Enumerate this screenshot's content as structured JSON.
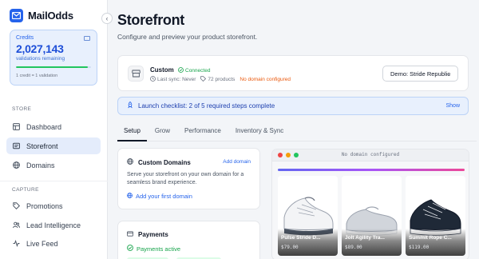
{
  "app": {
    "name": "MailOdds"
  },
  "credits": {
    "label": "Credits",
    "value": "2,027,143",
    "sub": "validations remaining",
    "progress": 0.96,
    "footnote": "1 credit = 1 validation"
  },
  "sidebar": {
    "section_store": "STORE",
    "section_capture": "CAPTURE",
    "items": [
      {
        "label": "Dashboard",
        "icon": "dashboard-icon"
      },
      {
        "label": "Storefront",
        "icon": "storefront-icon",
        "active": true
      },
      {
        "label": "Domains",
        "icon": "globe-icon"
      },
      {
        "label": "Promotions",
        "icon": "tag-icon"
      },
      {
        "label": "Lead Intelligence",
        "icon": "users-icon"
      },
      {
        "label": "Live Feed",
        "icon": "activity-icon"
      }
    ]
  },
  "header": {
    "title": "Storefront",
    "subtitle": "Configure and preview your product storefront."
  },
  "store": {
    "name": "Custom",
    "status": "Connected",
    "last_sync": "Last sync: Never",
    "products": "72 products",
    "domain_warning": "No domain configured",
    "selected_store": "Demo: Stride Republic"
  },
  "checklist": {
    "text": "Launch checklist: 2 of 5 required steps complete",
    "action": "Show"
  },
  "tabs": [
    {
      "label": "Setup",
      "active": true
    },
    {
      "label": "Grow"
    },
    {
      "label": "Performance"
    },
    {
      "label": "Inventory & Sync"
    }
  ],
  "custom_domains": {
    "title": "Custom Domains",
    "action": "Add domain",
    "description": "Serve your storefront on your own domain for a seamless brand experience.",
    "cta": "Add your first domain"
  },
  "payments": {
    "title": "Payments",
    "status": "Payments active"
  },
  "preview": {
    "url": "No domain configured",
    "products": [
      {
        "name": "Pulse Stride D...",
        "price": "$79.00"
      },
      {
        "name": "Jolt Agility Tra...",
        "price": "$89.00"
      },
      {
        "name": "Summit Rope C...",
        "price": "$119.00"
      }
    ]
  },
  "colors": {
    "accent": "#2563eb",
    "success": "#16a34a",
    "warning": "#ea580c"
  }
}
